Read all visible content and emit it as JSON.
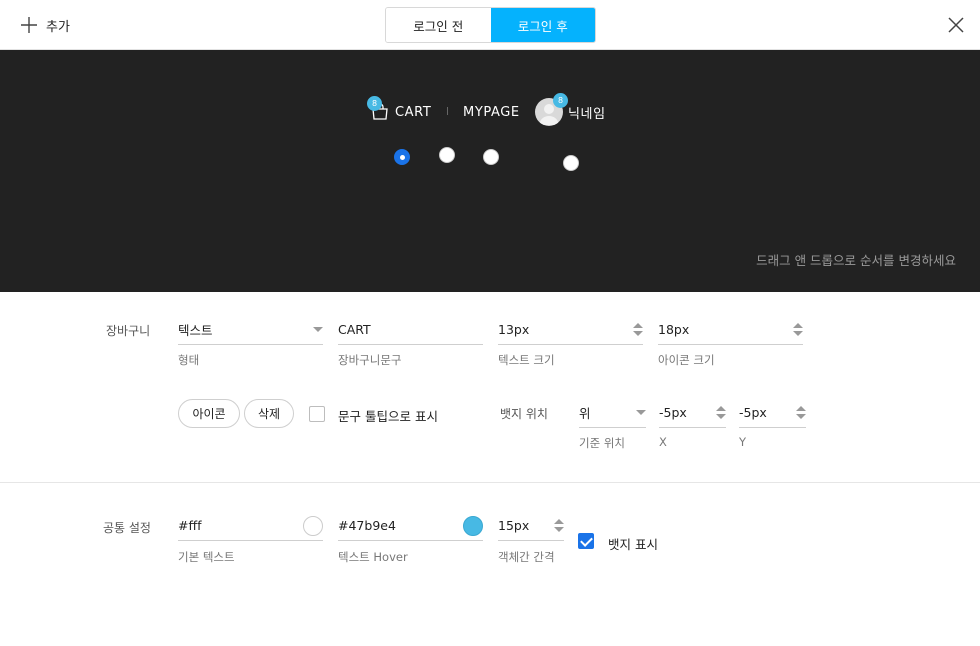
{
  "topbar": {
    "add_label": "추가",
    "toggle": {
      "before": "로그인 전",
      "after": "로그인 후",
      "selected": "after"
    }
  },
  "preview": {
    "cart_label": "CART",
    "cart_badge": "8",
    "mypage_label": "MYPAGE",
    "nickname_label": "닉네임",
    "nickname_badge": "8",
    "hint": "드래그 앤 드롭으로 순서를 변경하세요",
    "background": "#222222"
  },
  "cart_section": {
    "label": "장바구니",
    "type": {
      "value": "텍스트",
      "caption": "형태"
    },
    "text": {
      "value": "CART",
      "caption": "장바구니문구"
    },
    "text_size": {
      "value": "13px",
      "caption": "텍스트 크기"
    },
    "icon_size": {
      "value": "18px",
      "caption": "아이콘 크기"
    },
    "icon_button": "아이콘",
    "delete_button": "삭제",
    "tooltip_label": "문구 툴팁으로 표시",
    "badge_pos_label": "뱃지 위치",
    "badge_base": {
      "value": "위",
      "caption": "기준 위치"
    },
    "badge_x": {
      "value": "-5px",
      "caption": "X"
    },
    "badge_y": {
      "value": "-5px",
      "caption": "Y"
    }
  },
  "common_section": {
    "label": "공통 설정",
    "base_text": {
      "value": "#fff",
      "caption": "기본 텍스트",
      "color": "#ffffff"
    },
    "hover_text": {
      "value": "#47b9e4",
      "caption": "텍스트 Hover",
      "color": "#47b9e4"
    },
    "gap": {
      "value": "15px",
      "caption": "객체간 간격"
    },
    "show_badge_label": "뱃지 표시",
    "show_badge_checked": true
  },
  "colors": {
    "accent": "#05b2fd",
    "checkbox": "#1a73e8",
    "badge": "#47b9e4"
  }
}
